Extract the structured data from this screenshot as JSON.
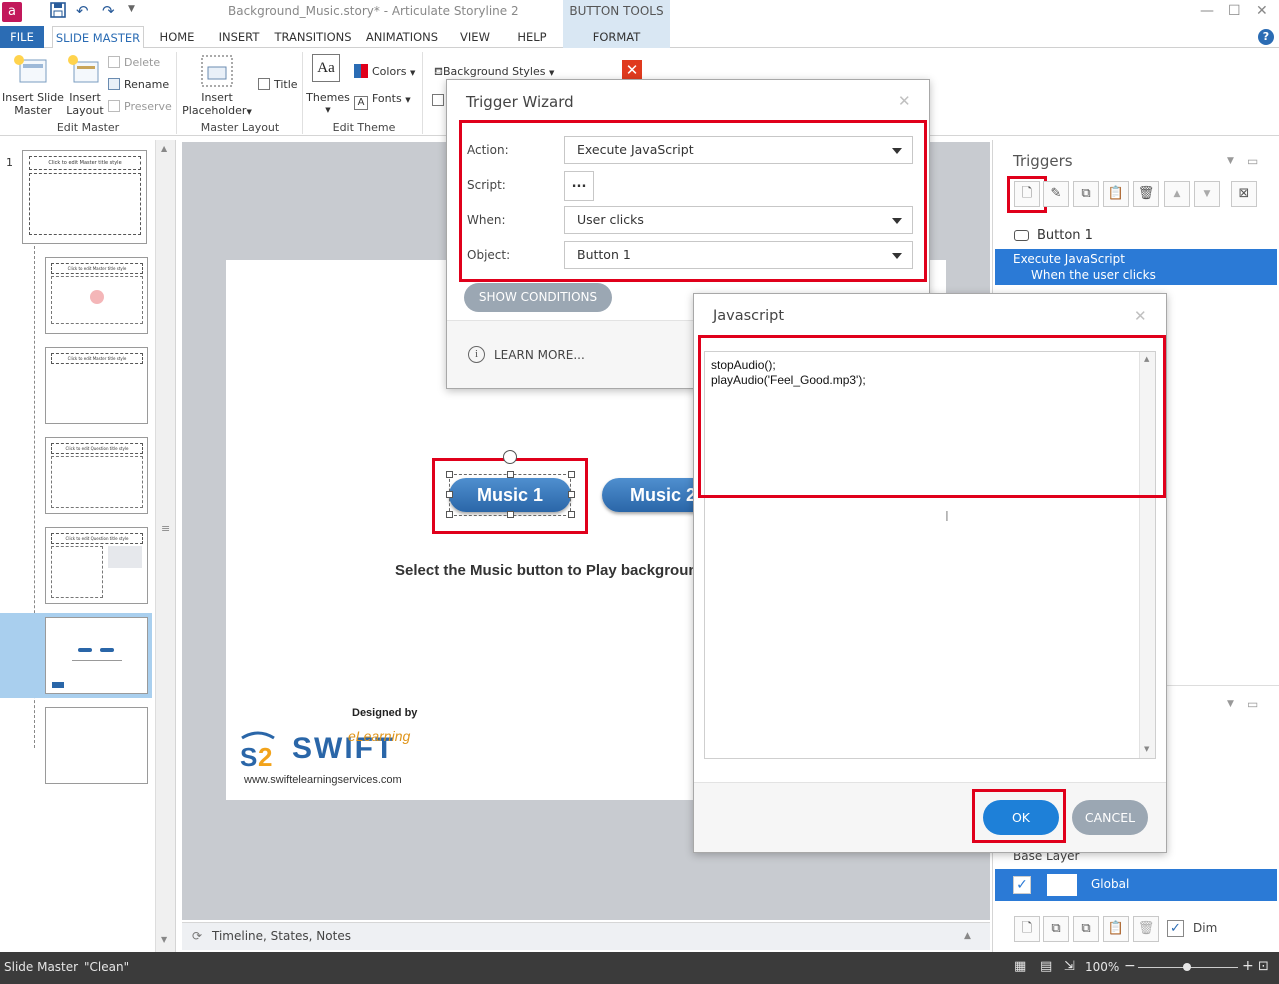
{
  "app": {
    "title": "Background_Music.story* - Articulate Storyline 2",
    "icon": "articulate-a-icon",
    "button_tools_label": "BUTTON TOOLS"
  },
  "tabs": [
    "FILE",
    "SLIDE MASTER",
    "HOME",
    "INSERT",
    "TRANSITIONS",
    "ANIMATIONS",
    "VIEW",
    "HELP",
    "FORMAT"
  ],
  "ribbon": {
    "insert_slide_master": "Insert Slide Master",
    "insert_slide_master_l1": "Insert Slide",
    "insert_slide_master_l2": "Master",
    "insert_layout_l1": "Insert",
    "insert_layout_l2": "Layout",
    "delete": "Delete",
    "rename": "Rename",
    "preserve": "Preserve",
    "edit_master": "Edit Master",
    "insert_placeholder_l1": "Insert",
    "insert_placeholder_l2": "Placeholder",
    "title_checkbox": "Title",
    "master_layout": "Master Layout",
    "themes": "Themes",
    "themes_icon_text": "Aa",
    "colors": "Colors",
    "fonts": "Fonts",
    "edit_theme": "Edit Theme",
    "background_styles": "Background Styles"
  },
  "slide_panel": {
    "slide_number": "1",
    "master_title": "Click to edit Master title style",
    "layout_title": "Click to edit Master title style",
    "question_title": "Click to edit Question title style"
  },
  "slide": {
    "button1": "Music 1",
    "button2": "Music 2",
    "instruction": "Select the Music button to Play background",
    "designed_by": "Designed by",
    "brand_swift": "SWIFT",
    "brand_elearning": "eLearning",
    "brand_url": "www.swiftelearningservices.com"
  },
  "bottom_bar": {
    "timeline": "Timeline, States, Notes"
  },
  "triggers": {
    "title": "Triggers",
    "object_name": "Button 1",
    "trigger_action": "Execute JavaScript",
    "trigger_when": "When the user clicks",
    "base_layer": "Base Layer",
    "global_layer": "Global",
    "dim": "Dim"
  },
  "trigger_wizard": {
    "title": "Trigger Wizard",
    "action_label": "Action:",
    "action_value": "Execute JavaScript",
    "script_label": "Script:",
    "script_button": "...",
    "when_label": "When:",
    "when_value": "User clicks",
    "object_label": "Object:",
    "object_value": "Button 1",
    "show_conditions": "SHOW CONDITIONS",
    "learn_more": "LEARN MORE..."
  },
  "javascript_dialog": {
    "title": "Javascript",
    "code_line1": "stopAudio();",
    "code_line2": "playAudio('Feel_Good.mp3');",
    "ok": "OK",
    "cancel": "CANCEL"
  },
  "statusbar": {
    "mode": "Slide Master",
    "theme": "\"Clean\"",
    "zoom": "100%"
  },
  "colors": {
    "accent": "#2b6cb4",
    "highlight_red": "#e0001b",
    "selected_row": "#2b7ad6",
    "button_blue": "#2a66a8"
  }
}
